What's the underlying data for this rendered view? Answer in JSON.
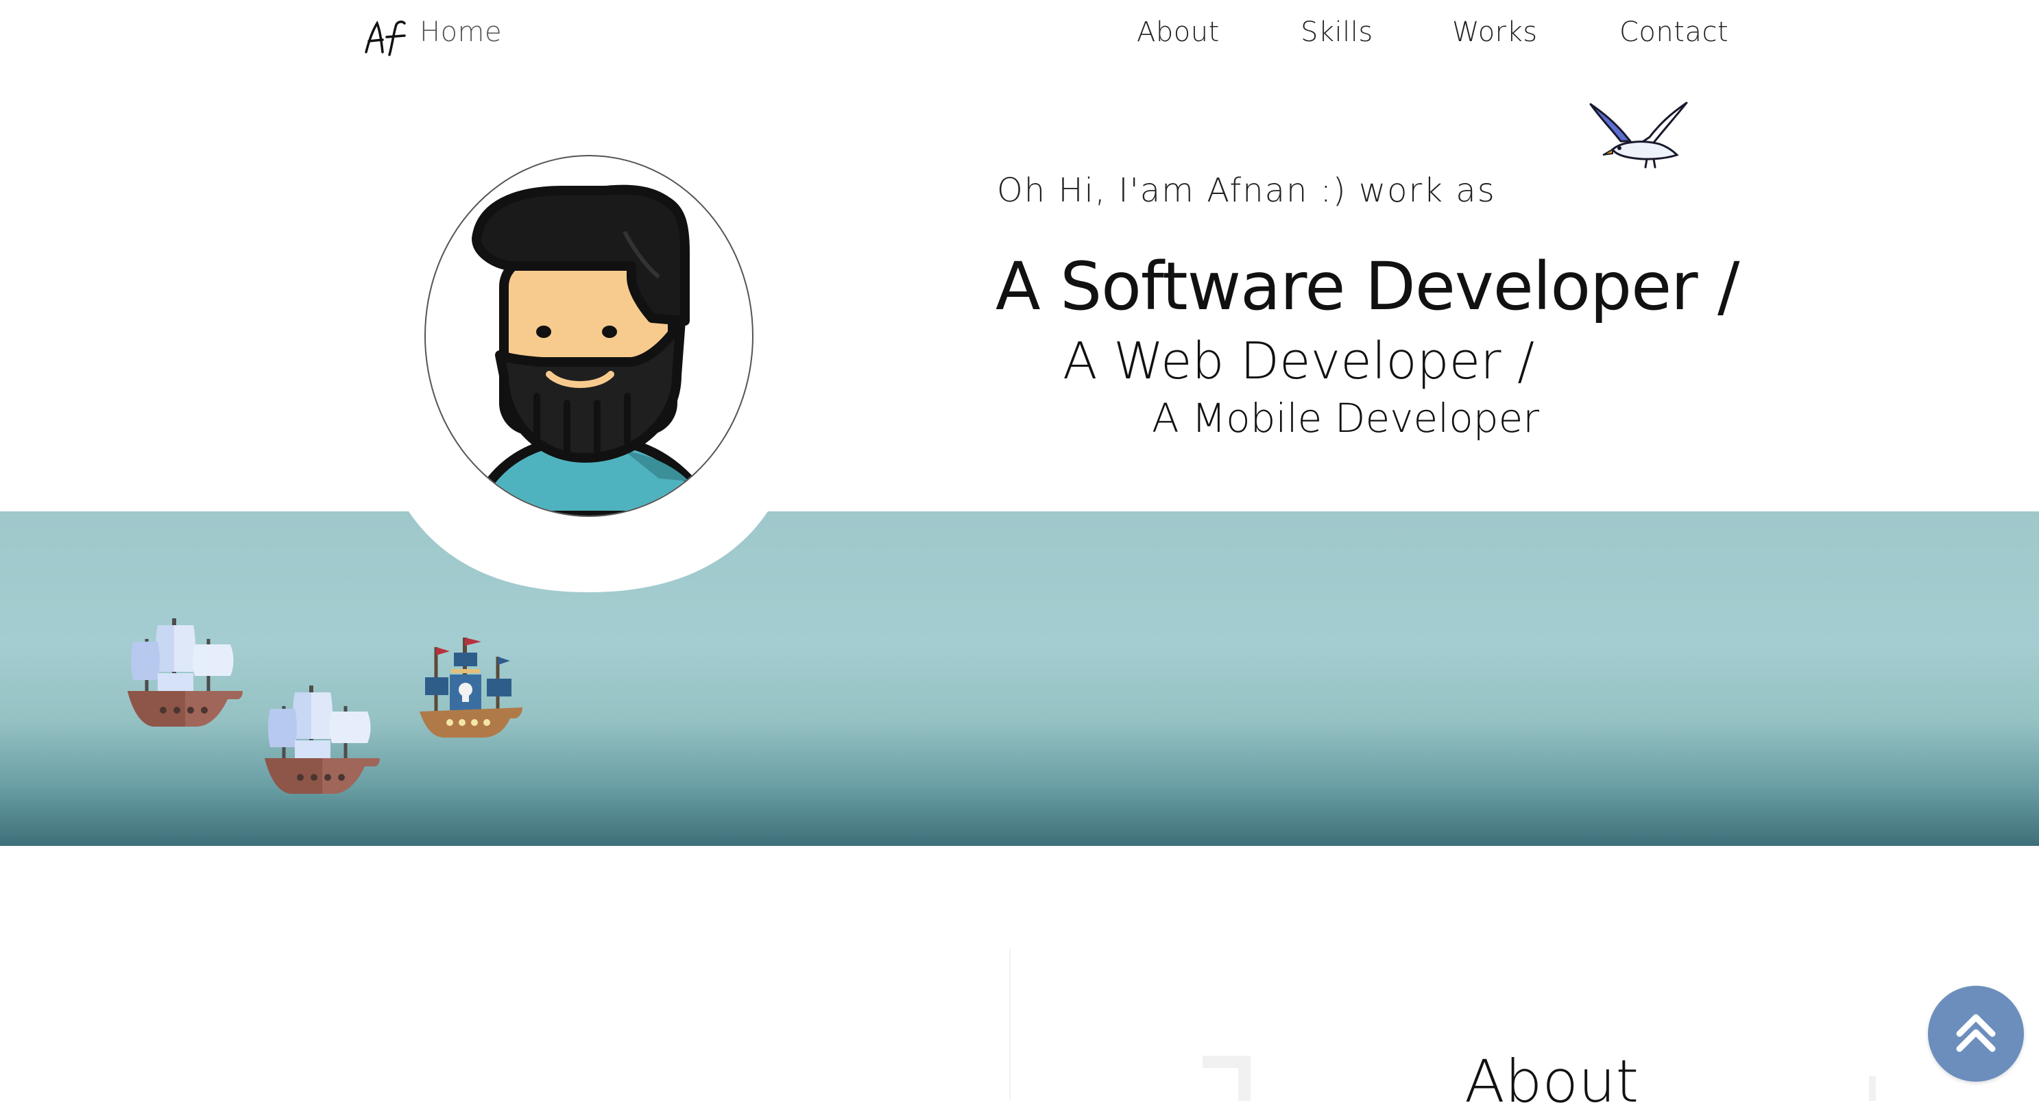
{
  "nav": {
    "home_label": "Home",
    "links": [
      "About",
      "Skills",
      "Works",
      "Contact"
    ]
  },
  "hero": {
    "greeting": "Oh Hi, I'am Afnan :) work as",
    "roles": [
      "A Software Developer /",
      "A Web Developer /",
      "A Mobile Developer"
    ]
  },
  "about": {
    "heading": "About"
  },
  "icons": {
    "logo": "af-monogram-logo",
    "seagull": "seagull-icon",
    "avatar": "bearded-man-avatar",
    "ships": [
      "sailing-ship-icon",
      "sailing-ship-icon",
      "pirate-ship-icon"
    ],
    "back_to_top": "double-chevron-up-icon"
  },
  "colors": {
    "sea_top": "#9fc8cb",
    "sea_bottom": "#3d6f78",
    "back_to_top": "#6b8ebd"
  }
}
